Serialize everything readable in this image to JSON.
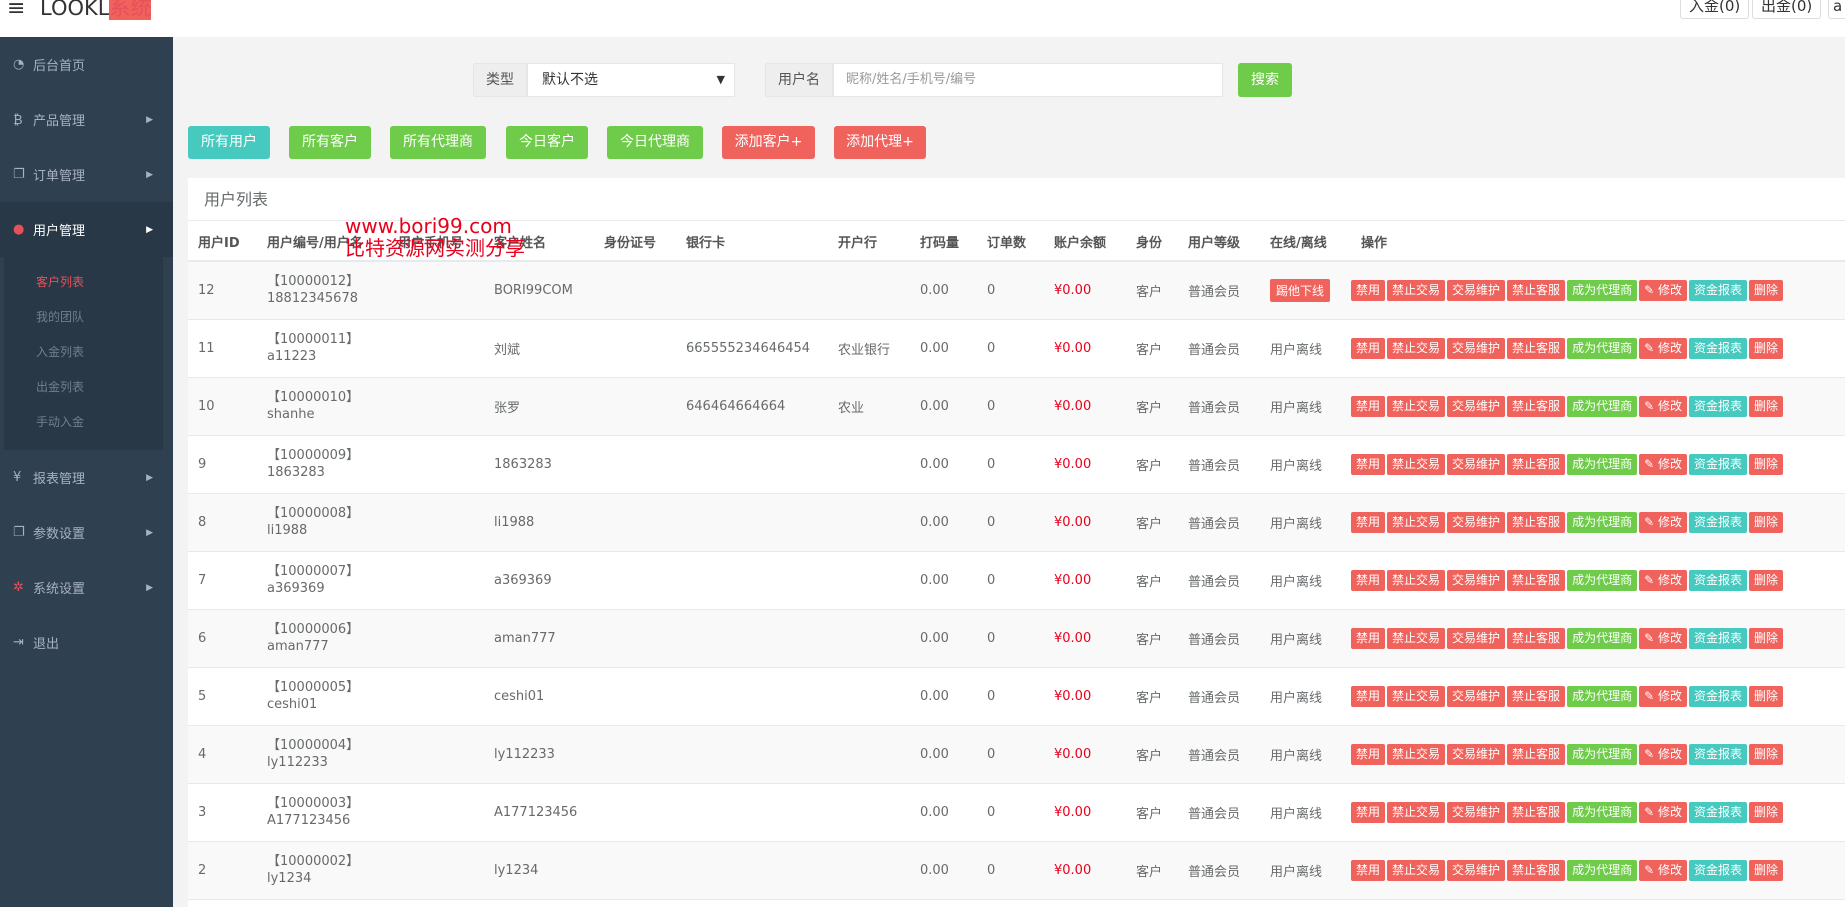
{
  "topbar": {
    "menu_icon": "hamburger-icon",
    "logo_main": "LOOKL",
    "logo_suffix": "系统",
    "deposit_btn": "入金(0)",
    "withdraw_btn": "出金(0)",
    "user_btn": "a"
  },
  "sidebar": {
    "items": [
      {
        "label": "后台首页",
        "icon": "dashboard-icon"
      },
      {
        "label": "产品管理",
        "icon": "bitcoin-icon"
      },
      {
        "label": "订单管理",
        "icon": "copy-icon"
      },
      {
        "label": "用户管理",
        "icon": "user-icon"
      },
      {
        "label": "报表管理",
        "icon": "yen-icon"
      },
      {
        "label": "参数设置",
        "icon": "copy-icon"
      },
      {
        "label": "系统设置",
        "icon": "cogs-icon"
      },
      {
        "label": "退出",
        "icon": "sign-out-icon"
      }
    ],
    "submenu": [
      "客户列表",
      "我的团队",
      "入金列表",
      "出金列表",
      "手动入金"
    ]
  },
  "search": {
    "type_label": "类型",
    "type_value": "默认不选",
    "username_label": "用户名",
    "username_placeholder": "昵称/姓名/手机号/编号",
    "search_btn": "搜索"
  },
  "filters": [
    "所有用户",
    "所有客户",
    "所有代理商",
    "今日客户",
    "今日代理商",
    "添加客户+",
    "添加代理+"
  ],
  "panel_title": "用户列表",
  "watermark": {
    "line1": "www.bori99.com",
    "line2": "比特资源网实测分享"
  },
  "table": {
    "headers": [
      "用户ID",
      "用户编号/用户名",
      "用户手机号",
      "客户姓名",
      "身份证号",
      "银行卡",
      "开户行",
      "打码量",
      "订单数",
      "账户余额",
      "身份",
      "用户等级",
      "在线/离线",
      "操作"
    ],
    "rows": [
      {
        "id": "12",
        "code": "【10000012】",
        "username": "18812345678",
        "phone": "",
        "name": "BORI99COM",
        "idcard": "",
        "bankcard": "",
        "bank": "",
        "code_amount": "0.00",
        "orders": "0",
        "balance": "¥0.00",
        "role": "客户",
        "level": "普通会员",
        "status": "踢他下线"
      },
      {
        "id": "11",
        "code": "【10000011】",
        "username": "a11223",
        "phone": "",
        "name": "刘斌",
        "idcard": "",
        "bankcard": "665555234646454",
        "bank": "农业银行",
        "code_amount": "0.00",
        "orders": "0",
        "balance": "¥0.00",
        "role": "客户",
        "level": "普通会员",
        "status": "用户离线"
      },
      {
        "id": "10",
        "code": "【10000010】",
        "username": "shanhe",
        "phone": "",
        "name": "张罗",
        "idcard": "",
        "bankcard": "646464664664",
        "bank": "农业",
        "code_amount": "0.00",
        "orders": "0",
        "balance": "¥0.00",
        "role": "客户",
        "level": "普通会员",
        "status": "用户离线"
      },
      {
        "id": "9",
        "code": "【10000009】",
        "username": "1863283",
        "phone": "",
        "name": "1863283",
        "idcard": "",
        "bankcard": "",
        "bank": "",
        "code_amount": "0.00",
        "orders": "0",
        "balance": "¥0.00",
        "role": "客户",
        "level": "普通会员",
        "status": "用户离线"
      },
      {
        "id": "8",
        "code": "【10000008】",
        "username": "li1988",
        "phone": "",
        "name": "li1988",
        "idcard": "",
        "bankcard": "",
        "bank": "",
        "code_amount": "0.00",
        "orders": "0",
        "balance": "¥0.00",
        "role": "客户",
        "level": "普通会员",
        "status": "用户离线"
      },
      {
        "id": "7",
        "code": "【10000007】",
        "username": "a369369",
        "phone": "",
        "name": "a369369",
        "idcard": "",
        "bankcard": "",
        "bank": "",
        "code_amount": "0.00",
        "orders": "0",
        "balance": "¥0.00",
        "role": "客户",
        "level": "普通会员",
        "status": "用户离线"
      },
      {
        "id": "6",
        "code": "【10000006】",
        "username": "aman777",
        "phone": "",
        "name": "aman777",
        "idcard": "",
        "bankcard": "",
        "bank": "",
        "code_amount": "0.00",
        "orders": "0",
        "balance": "¥0.00",
        "role": "客户",
        "level": "普通会员",
        "status": "用户离线"
      },
      {
        "id": "5",
        "code": "【10000005】",
        "username": "ceshi01",
        "phone": "",
        "name": "ceshi01",
        "idcard": "",
        "bankcard": "",
        "bank": "",
        "code_amount": "0.00",
        "orders": "0",
        "balance": "¥0.00",
        "role": "客户",
        "level": "普通会员",
        "status": "用户离线"
      },
      {
        "id": "4",
        "code": "【10000004】",
        "username": "ly112233",
        "phone": "",
        "name": "ly112233",
        "idcard": "",
        "bankcard": "",
        "bank": "",
        "code_amount": "0.00",
        "orders": "0",
        "balance": "¥0.00",
        "role": "客户",
        "level": "普通会员",
        "status": "用户离线"
      },
      {
        "id": "3",
        "code": "【10000003】",
        "username": "A177123456",
        "phone": "",
        "name": "A177123456",
        "idcard": "",
        "bankcard": "",
        "bank": "",
        "code_amount": "0.00",
        "orders": "0",
        "balance": "¥0.00",
        "role": "客户",
        "level": "普通会员",
        "status": "用户离线"
      },
      {
        "id": "2",
        "code": "【10000002】",
        "username": "ly1234",
        "phone": "",
        "name": "ly1234",
        "idcard": "",
        "bankcard": "",
        "bank": "",
        "code_amount": "0.00",
        "orders": "0",
        "balance": "¥0.00",
        "role": "客户",
        "level": "普通会员",
        "status": "用户离线"
      }
    ],
    "actions": [
      {
        "label": "禁用",
        "color": "#f0625c"
      },
      {
        "label": "禁止交易",
        "color": "#f0625c"
      },
      {
        "label": "交易维护",
        "color": "#f0625c"
      },
      {
        "label": "禁止客服",
        "color": "#f0625c"
      },
      {
        "label": "成为代理商",
        "color": "#6fcc4a"
      },
      {
        "label": "✎ 修改",
        "color": "#f0625c"
      },
      {
        "label": "资金报表",
        "color": "#46cabf"
      },
      {
        "label": "删除",
        "color": "#f0625c"
      }
    ]
  },
  "colors": {
    "sidebar": "#2f4050",
    "accent_red": "#f0625c",
    "accent_green": "#6fcc4a",
    "accent_teal": "#46cabf",
    "balance": "#e8001c"
  }
}
